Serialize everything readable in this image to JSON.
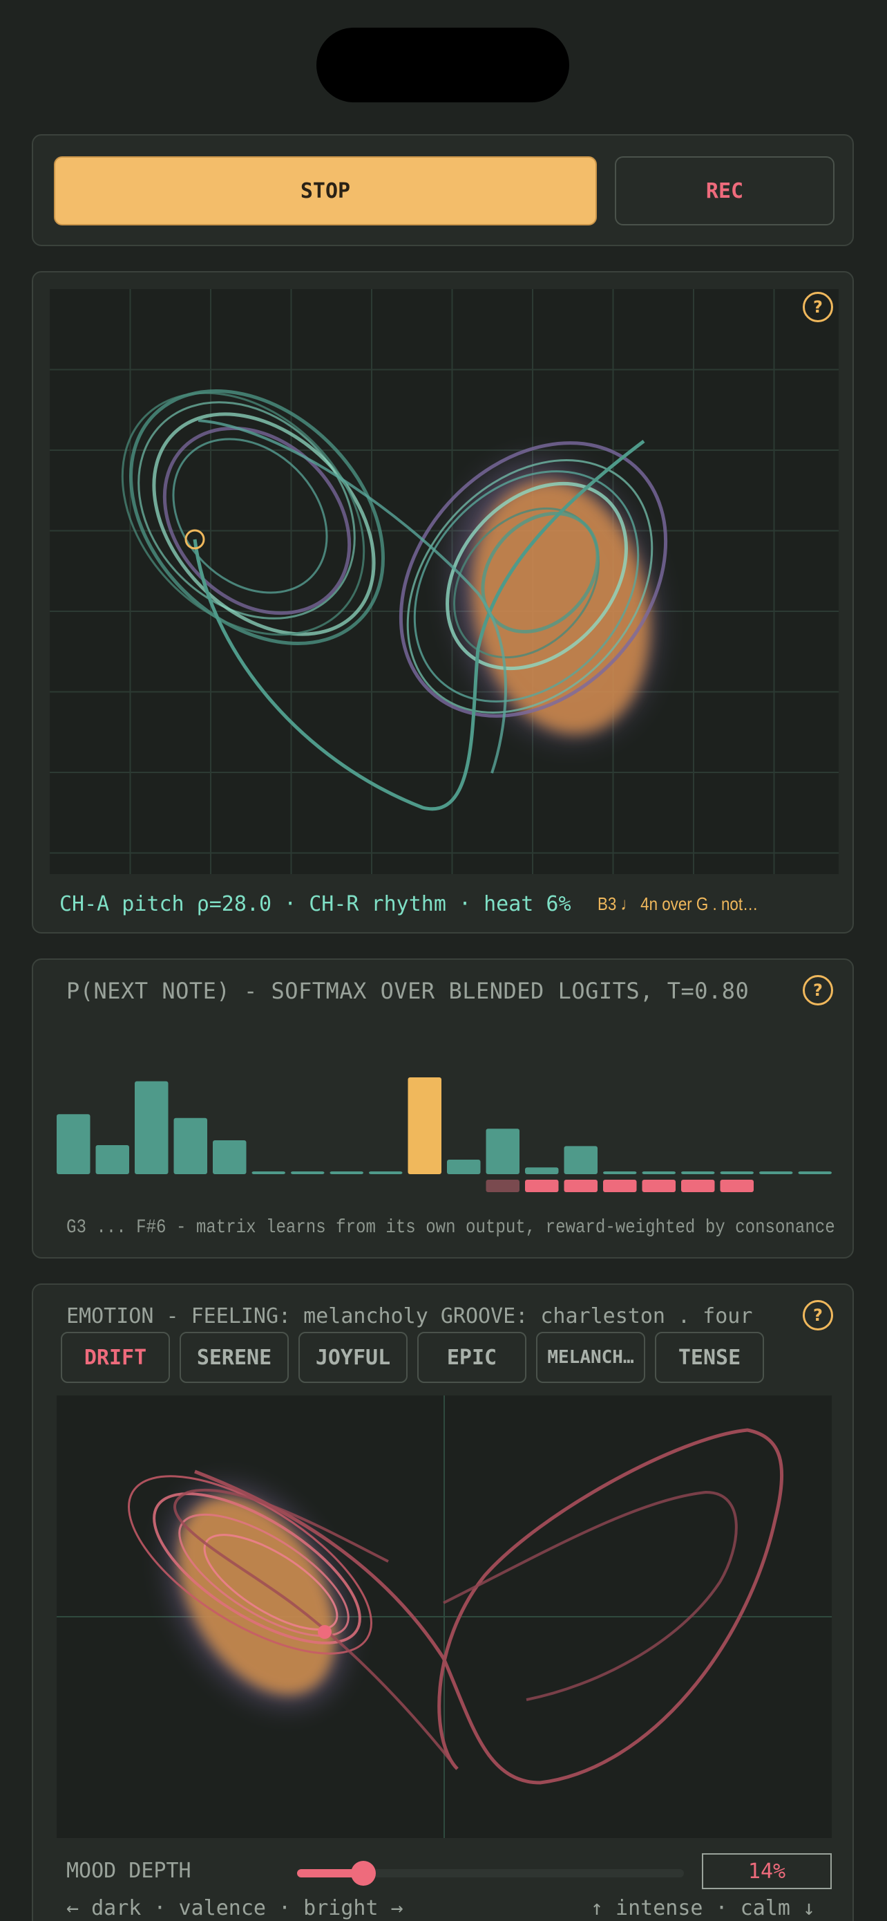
{
  "transport": {
    "stop_label": "STOP",
    "rec_label": "REC"
  },
  "attractor": {
    "help_label": "?",
    "status_main": "CH-A pitch ρ=28.0 · CH-R rhythm · heat 6%",
    "status_note": "B3 ♩ 4n over G . not…"
  },
  "distribution": {
    "help_label": "?",
    "title": "P(NEXT NOTE) - SOFTMAX OVER BLENDED LOGITS, T=0.80",
    "footer": "G3 ... F#6 - matrix learns from its own output, reward-weighted by consonance",
    "bars": [
      0.62,
      0.3,
      0.96,
      0.58,
      0.35,
      0.02,
      0.02,
      0.02,
      0.02,
      1.0,
      0.15,
      0.47,
      0.07,
      0.29,
      0.02,
      0.02,
      0.02,
      0.02,
      0.02,
      0.02
    ],
    "highlight_index": 9,
    "reward_flags": [
      0,
      0,
      0,
      0,
      0,
      0,
      0,
      0,
      0,
      0,
      0,
      1,
      1,
      1,
      1,
      1,
      1,
      1,
      0,
      0
    ]
  },
  "emotion": {
    "help_label": "?",
    "title": "EMOTION - FEELING: melancholy   GROOVE: charleston . four",
    "chips": [
      {
        "label": "DRIFT",
        "active": true
      },
      {
        "label": "SERENE",
        "active": false
      },
      {
        "label": "JOYFUL",
        "active": false
      },
      {
        "label": "EPIC",
        "active": false
      },
      {
        "label": "MELANCH…",
        "active": false
      },
      {
        "label": "TENSE",
        "active": false
      }
    ],
    "mood_label": "MOOD DEPTH",
    "mood_depth": 0.14,
    "mood_value": "14%",
    "axis_left": "← dark · valence · bright →",
    "axis_right": "↑ intense · calm ↓"
  },
  "colors": {
    "accent": "#f0b85c",
    "teal": "#4f9a8a",
    "pink": "#ee6b7c",
    "panel": "#262b27"
  }
}
